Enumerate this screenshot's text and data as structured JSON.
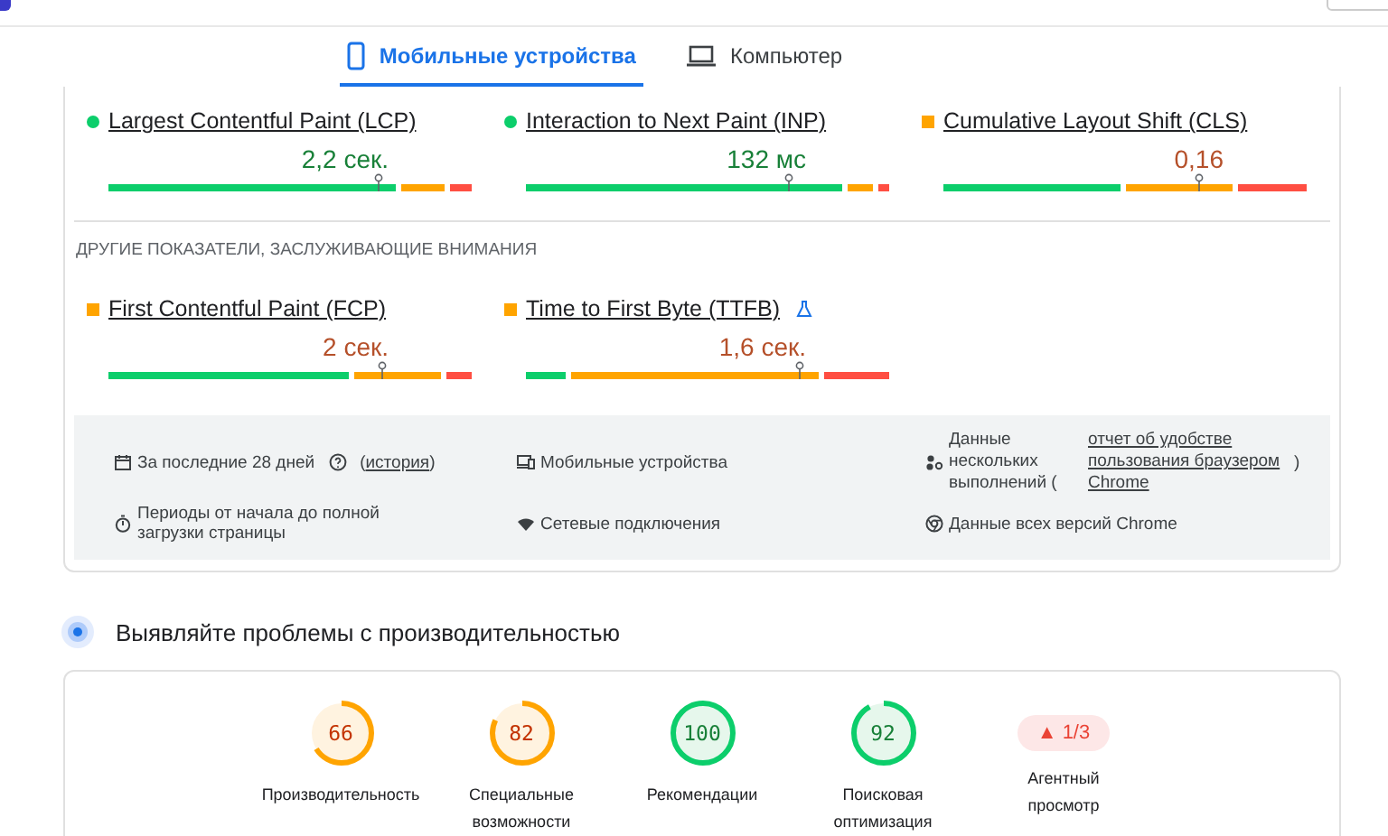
{
  "tabs": [
    {
      "label": "Мобильные устройства",
      "selected": true
    },
    {
      "label": "Компьютер",
      "selected": false
    }
  ],
  "core_metrics": [
    {
      "name": "Largest Contentful Paint (LCP)",
      "kind": "good",
      "color": "#0cce6b",
      "value": "2,2 сек.",
      "experimental": false,
      "segments": [
        {
          "kind": "good",
          "level": 0.79
        },
        {
          "kind": "average"
        },
        {
          "kind": "poor",
          "level": 0.06
        }
      ],
      "marker": {
        "level": 0.74
      }
    },
    {
      "name": "Interaction to Next Paint (INP)",
      "kind": "good",
      "color": "#0cce6b",
      "value": "132 мс",
      "experimental": false,
      "segments": [
        {
          "kind": "good",
          "level": 0.87
        },
        {
          "kind": "average"
        },
        {
          "kind": "poor",
          "level": 0.03
        }
      ],
      "marker": {
        "level": 0.72
      }
    },
    {
      "name": "Cumulative Layout Shift (CLS)",
      "kind": "average",
      "color": "#ffa400",
      "value": "0,16",
      "experimental": false,
      "segments": [
        {
          "kind": "good",
          "level": 0.49
        },
        {
          "kind": "average"
        },
        {
          "kind": "poor",
          "level": 0.19
        }
      ],
      "marker": {
        "level": 0.7
      }
    }
  ],
  "other_title": "ДРУГИЕ ПОКАЗАТЕЛИ, ЗАСЛУЖИВАЮЩИЕ ВНИМАНИЯ",
  "other_metrics": [
    {
      "name": "First Contentful Paint (FCP)",
      "kind": "average",
      "color": "#ffa400",
      "value": "2 сек.",
      "experimental": false,
      "segments": [
        {
          "kind": "good",
          "level": 0.66
        },
        {
          "kind": "average"
        },
        {
          "kind": "poor",
          "level": 0.07
        }
      ],
      "marker": {
        "level": 0.75
      }
    },
    {
      "name": "Time to First Byte (TTFB)",
      "kind": "average",
      "color": "#ffa400",
      "value": "1,6 сек.",
      "experimental": true,
      "segments": [
        {
          "kind": "good",
          "level": 0.11
        },
        {
          "kind": "average"
        },
        {
          "kind": "poor",
          "level": 0.18
        }
      ],
      "marker": {
        "level": 0.75
      }
    }
  ],
  "info": [
    {
      "text": "За последние 28 дней",
      "help": true,
      "link": "история",
      "link_before": "(",
      "link_after": ")"
    },
    {
      "text": "Мобильные устройства",
      "help": false
    },
    {
      "text": "Данные нескольких выполнений (",
      "help": false,
      "link": "отчет об удобстве пользования браузером Chrome",
      "link_after": ")"
    },
    {
      "text": "Периоды от начала до полной загрузки страницы",
      "help": false
    },
    {
      "text": "Сетевые подключения",
      "help": false
    },
    {
      "text": "Данные всех версий Chrome",
      "help": false
    }
  ],
  "diagnose_title": "Выявляйте проблемы с производительностью",
  "scores": [
    {
      "kind": "gauge",
      "value": "66",
      "label": "Производительность",
      "color": "#ffa400",
      "level": 0.66
    },
    {
      "kind": "gauge",
      "value": "82",
      "label": "Специальные возможности",
      "color": "#ffa400",
      "level": 0.82
    },
    {
      "kind": "gauge",
      "value": "100",
      "label": "Рекомендации",
      "color": "#0cce6b",
      "level": 1
    },
    {
      "kind": "gauge",
      "value": "92",
      "label": "Поисковая оптимизация",
      "color": "#0cce6b",
      "level": 0.92
    },
    {
      "kind": "badge",
      "value": "▲ 1/3",
      "label": "Агентный просмотр"
    }
  ]
}
